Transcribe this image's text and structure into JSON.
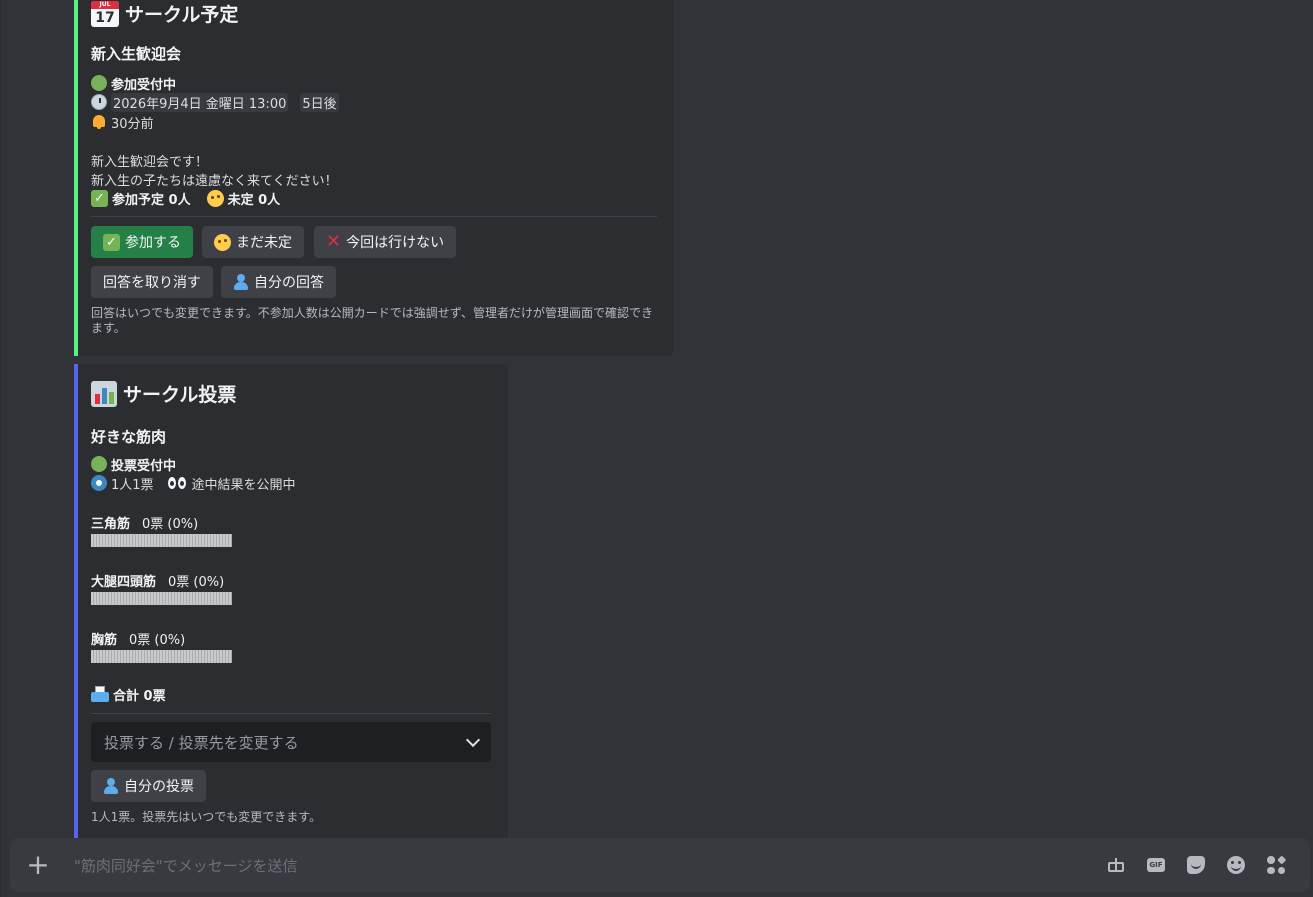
{
  "event": {
    "title": "サークル予定",
    "cal_month": "JUL",
    "cal_day": "17",
    "name": "新入生歓迎会",
    "status": "参加受付中",
    "datetime": "2026年9月4日 金曜日 13:00",
    "relative": "5日後",
    "reminder": "30分前",
    "description_line1": "新入生歓迎会です！",
    "description_line2": "新入生の子たちは遠慮なく来てください！",
    "going_count": "参加予定 0人",
    "maybe_count": "未定 0人",
    "buttons": {
      "join": "参加する",
      "maybe": "まだ未定",
      "decline": "今回は行けない",
      "cancel": "回答を取り消す",
      "mine": "自分の回答"
    },
    "footer": "回答はいつでも変更できます。不参加人数は公開カードでは強調せず、管理者だけが管理画面で確認できます。",
    "accent": "#57f287"
  },
  "poll": {
    "title": "サークル投票",
    "question": "好きな筋肉",
    "status": "投票受付中",
    "mode": "1人1票",
    "visibility": "途中結果を公開中",
    "options": [
      {
        "name": "三角筋",
        "votes": "0票 (0%)",
        "percent": 0
      },
      {
        "name": "大腿四頭筋",
        "votes": "0票 (0%)",
        "percent": 0
      },
      {
        "name": "胸筋",
        "votes": "0票 (0%)",
        "percent": 0
      }
    ],
    "total": "合計 0票",
    "select_placeholder": "投票する / 投票先を変更する",
    "mine_button": "自分の投票",
    "footer": "1人1票。投票先はいつでも変更できます。",
    "accent": "#5865f2"
  },
  "composer": {
    "placeholder": "\"筋肉同好会\"でメッセージを送信",
    "icons": [
      "gift-icon",
      "gif-icon",
      "sticker-icon",
      "emoji-icon",
      "apps-icon"
    ]
  }
}
